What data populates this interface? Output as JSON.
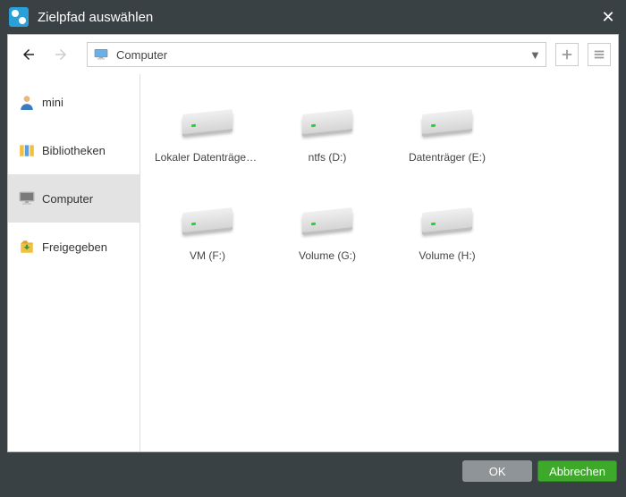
{
  "window": {
    "title": "Zielpfad auswählen"
  },
  "pathbar": {
    "location": "Computer"
  },
  "sidebar": {
    "items": [
      {
        "label": "mini",
        "icon": "user"
      },
      {
        "label": "Bibliotheken",
        "icon": "library"
      },
      {
        "label": "Computer",
        "icon": "computer"
      },
      {
        "label": "Freigegeben",
        "icon": "shared"
      }
    ],
    "selected_index": 2
  },
  "drives": [
    {
      "label": "Lokaler Datenträger (..."
    },
    {
      "label": "ntfs (D:)"
    },
    {
      "label": "Datenträger (E:)"
    },
    {
      "label": "VM (F:)"
    },
    {
      "label": "Volume (G:)"
    },
    {
      "label": "Volume (H:)"
    }
  ],
  "buttons": {
    "ok": "OK",
    "cancel": "Abbrechen"
  }
}
